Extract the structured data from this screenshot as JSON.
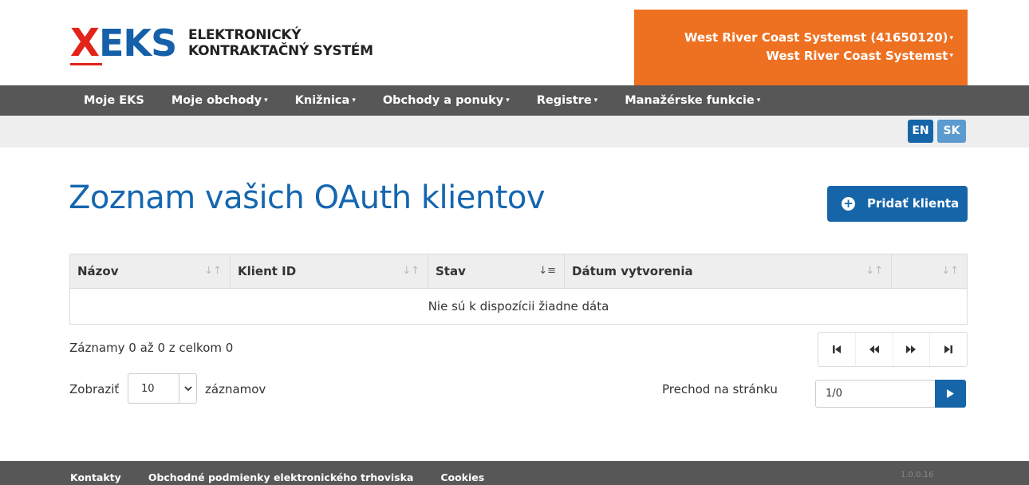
{
  "header": {
    "logo": {
      "x_mark": "X",
      "eks_mark": "EKS",
      "line1": "ELEKTRONICKÝ",
      "line2": "KONTRAKTAČNÝ SYSTÉM"
    },
    "account": {
      "organization": "West River Coast Systemst (41650120)",
      "user": "West River Coast Systemst"
    }
  },
  "nav": {
    "items": [
      {
        "label": "Moje EKS",
        "dropdown": false
      },
      {
        "label": "Moje obchody",
        "dropdown": true
      },
      {
        "label": "Knižnica",
        "dropdown": true
      },
      {
        "label": "Obchody a ponuky",
        "dropdown": true
      },
      {
        "label": "Registre",
        "dropdown": true
      },
      {
        "label": "Manažérske funkcie",
        "dropdown": true
      }
    ]
  },
  "lang": {
    "en": "EN",
    "sk": "SK"
  },
  "page": {
    "title": "Zoznam vašich OAuth klientov",
    "add_button": "Pridať klienta"
  },
  "table": {
    "columns": [
      {
        "label": "Názov",
        "sort": "neutral"
      },
      {
        "label": "Klient ID",
        "sort": "neutral"
      },
      {
        "label": "Stav",
        "sort": "active"
      },
      {
        "label": "Dátum vytvorenia",
        "sort": "neutral"
      },
      {
        "label": "",
        "sort": "neutral"
      }
    ],
    "empty_message": "Nie sú k dispozícii žiadne dáta"
  },
  "info": {
    "records": "Záznamy 0 až 0 z celkom 0",
    "show_prefix": "Zobraziť",
    "page_size": "10",
    "show_suffix": "záznamov",
    "goto_label": "Prechod na stránku",
    "goto_value": "1/0"
  },
  "footer": {
    "links": [
      "Kontakty",
      "Obchodné podmienky elektronického trhoviska",
      "Cookies"
    ],
    "version": "1.0.0.16"
  },
  "colors": {
    "brand_blue": "#1565a8",
    "brand_red": "#e2231a",
    "account_orange": "#ee7122",
    "nav_gray": "#575757"
  }
}
